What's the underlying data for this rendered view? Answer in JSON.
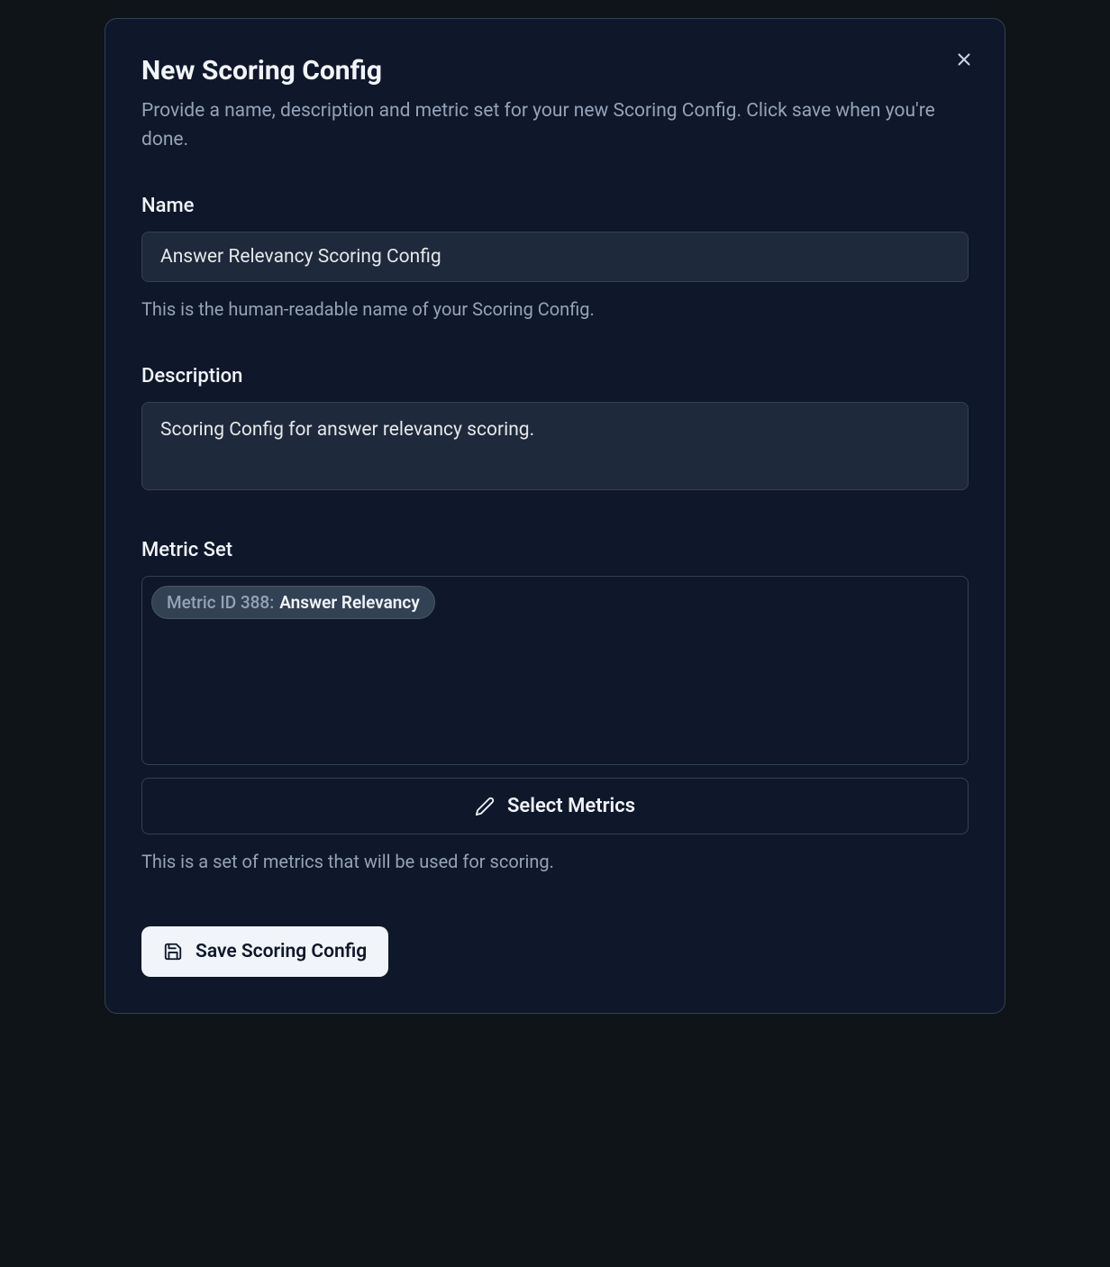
{
  "modal": {
    "title": "New Scoring Config",
    "subtitle": "Provide a name, description and metric set for your new Scoring Config. Click save when you're done."
  },
  "form": {
    "name": {
      "label": "Name",
      "value": "Answer Relevancy Scoring Config",
      "help": "This is the human-readable name of your Scoring Config."
    },
    "description": {
      "label": "Description",
      "value": "Scoring Config for answer relevancy scoring."
    },
    "metricSet": {
      "label": "Metric Set",
      "metrics": [
        {
          "id_label": "Metric ID 388:",
          "name": "Answer Relevancy"
        }
      ],
      "selectButton": "Select Metrics",
      "help": "This is a set of metrics that will be used for scoring."
    }
  },
  "actions": {
    "save": "Save Scoring Config"
  }
}
